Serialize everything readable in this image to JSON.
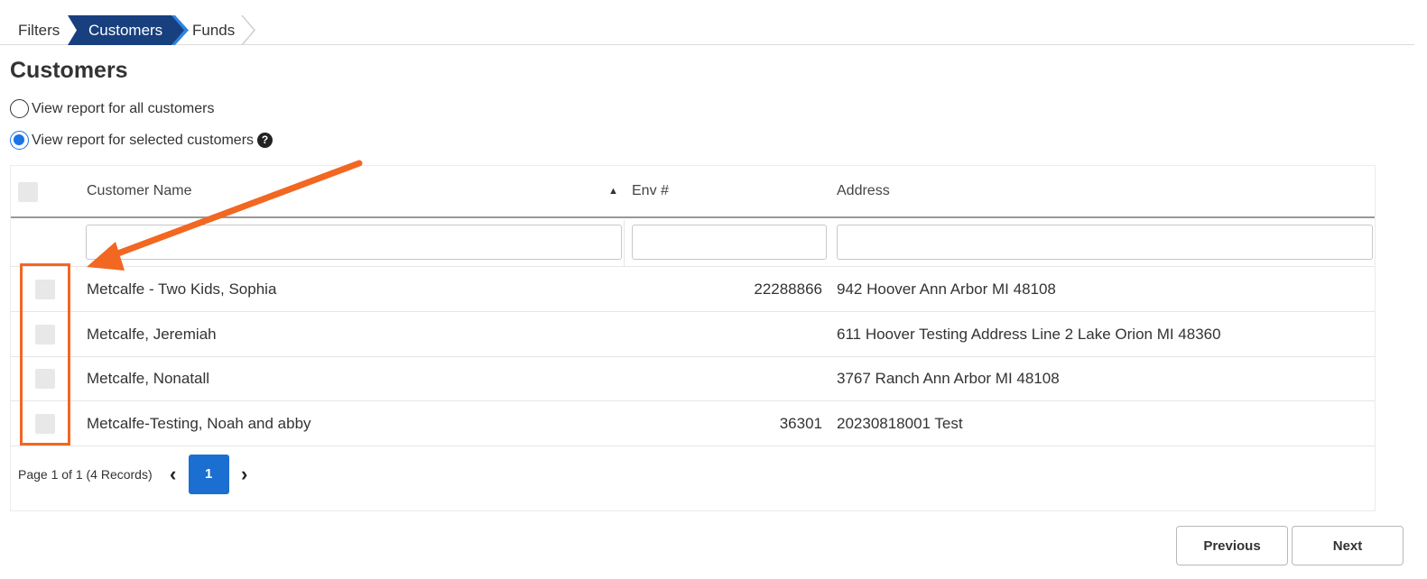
{
  "breadcrumb": {
    "steps": [
      "Filters",
      "Customers",
      "Funds"
    ]
  },
  "page": {
    "title": "Customers"
  },
  "options": {
    "all_label": "View report for all customers",
    "selected_label": "View report for selected customers",
    "selected_value": "selected"
  },
  "table": {
    "headers": {
      "name": "Customer Name",
      "env": "Env #",
      "address": "Address"
    },
    "rows": [
      {
        "name": "Metcalfe - Two Kids, Sophia",
        "env": "22288866",
        "address": "942 Hoover Ann Arbor MI 48108"
      },
      {
        "name": "Metcalfe, Jeremiah",
        "env": "",
        "address": "611 Hoover Testing Address Line 2 Lake Orion MI 48360"
      },
      {
        "name": "Metcalfe, Nonatall",
        "env": "",
        "address": "3767 Ranch Ann Arbor MI 48108"
      },
      {
        "name": "Metcalfe-Testing, Noah and abby",
        "env": "36301",
        "address": "20230818001 Test"
      }
    ]
  },
  "pager": {
    "info": "Page 1 of 1 (4 Records)",
    "current": "1"
  },
  "footer": {
    "previous_label": "Previous",
    "next_label": "Next"
  },
  "colors": {
    "accent": "#1a6fd1",
    "step_active": "#183f7e",
    "annotation": "#f26722"
  }
}
